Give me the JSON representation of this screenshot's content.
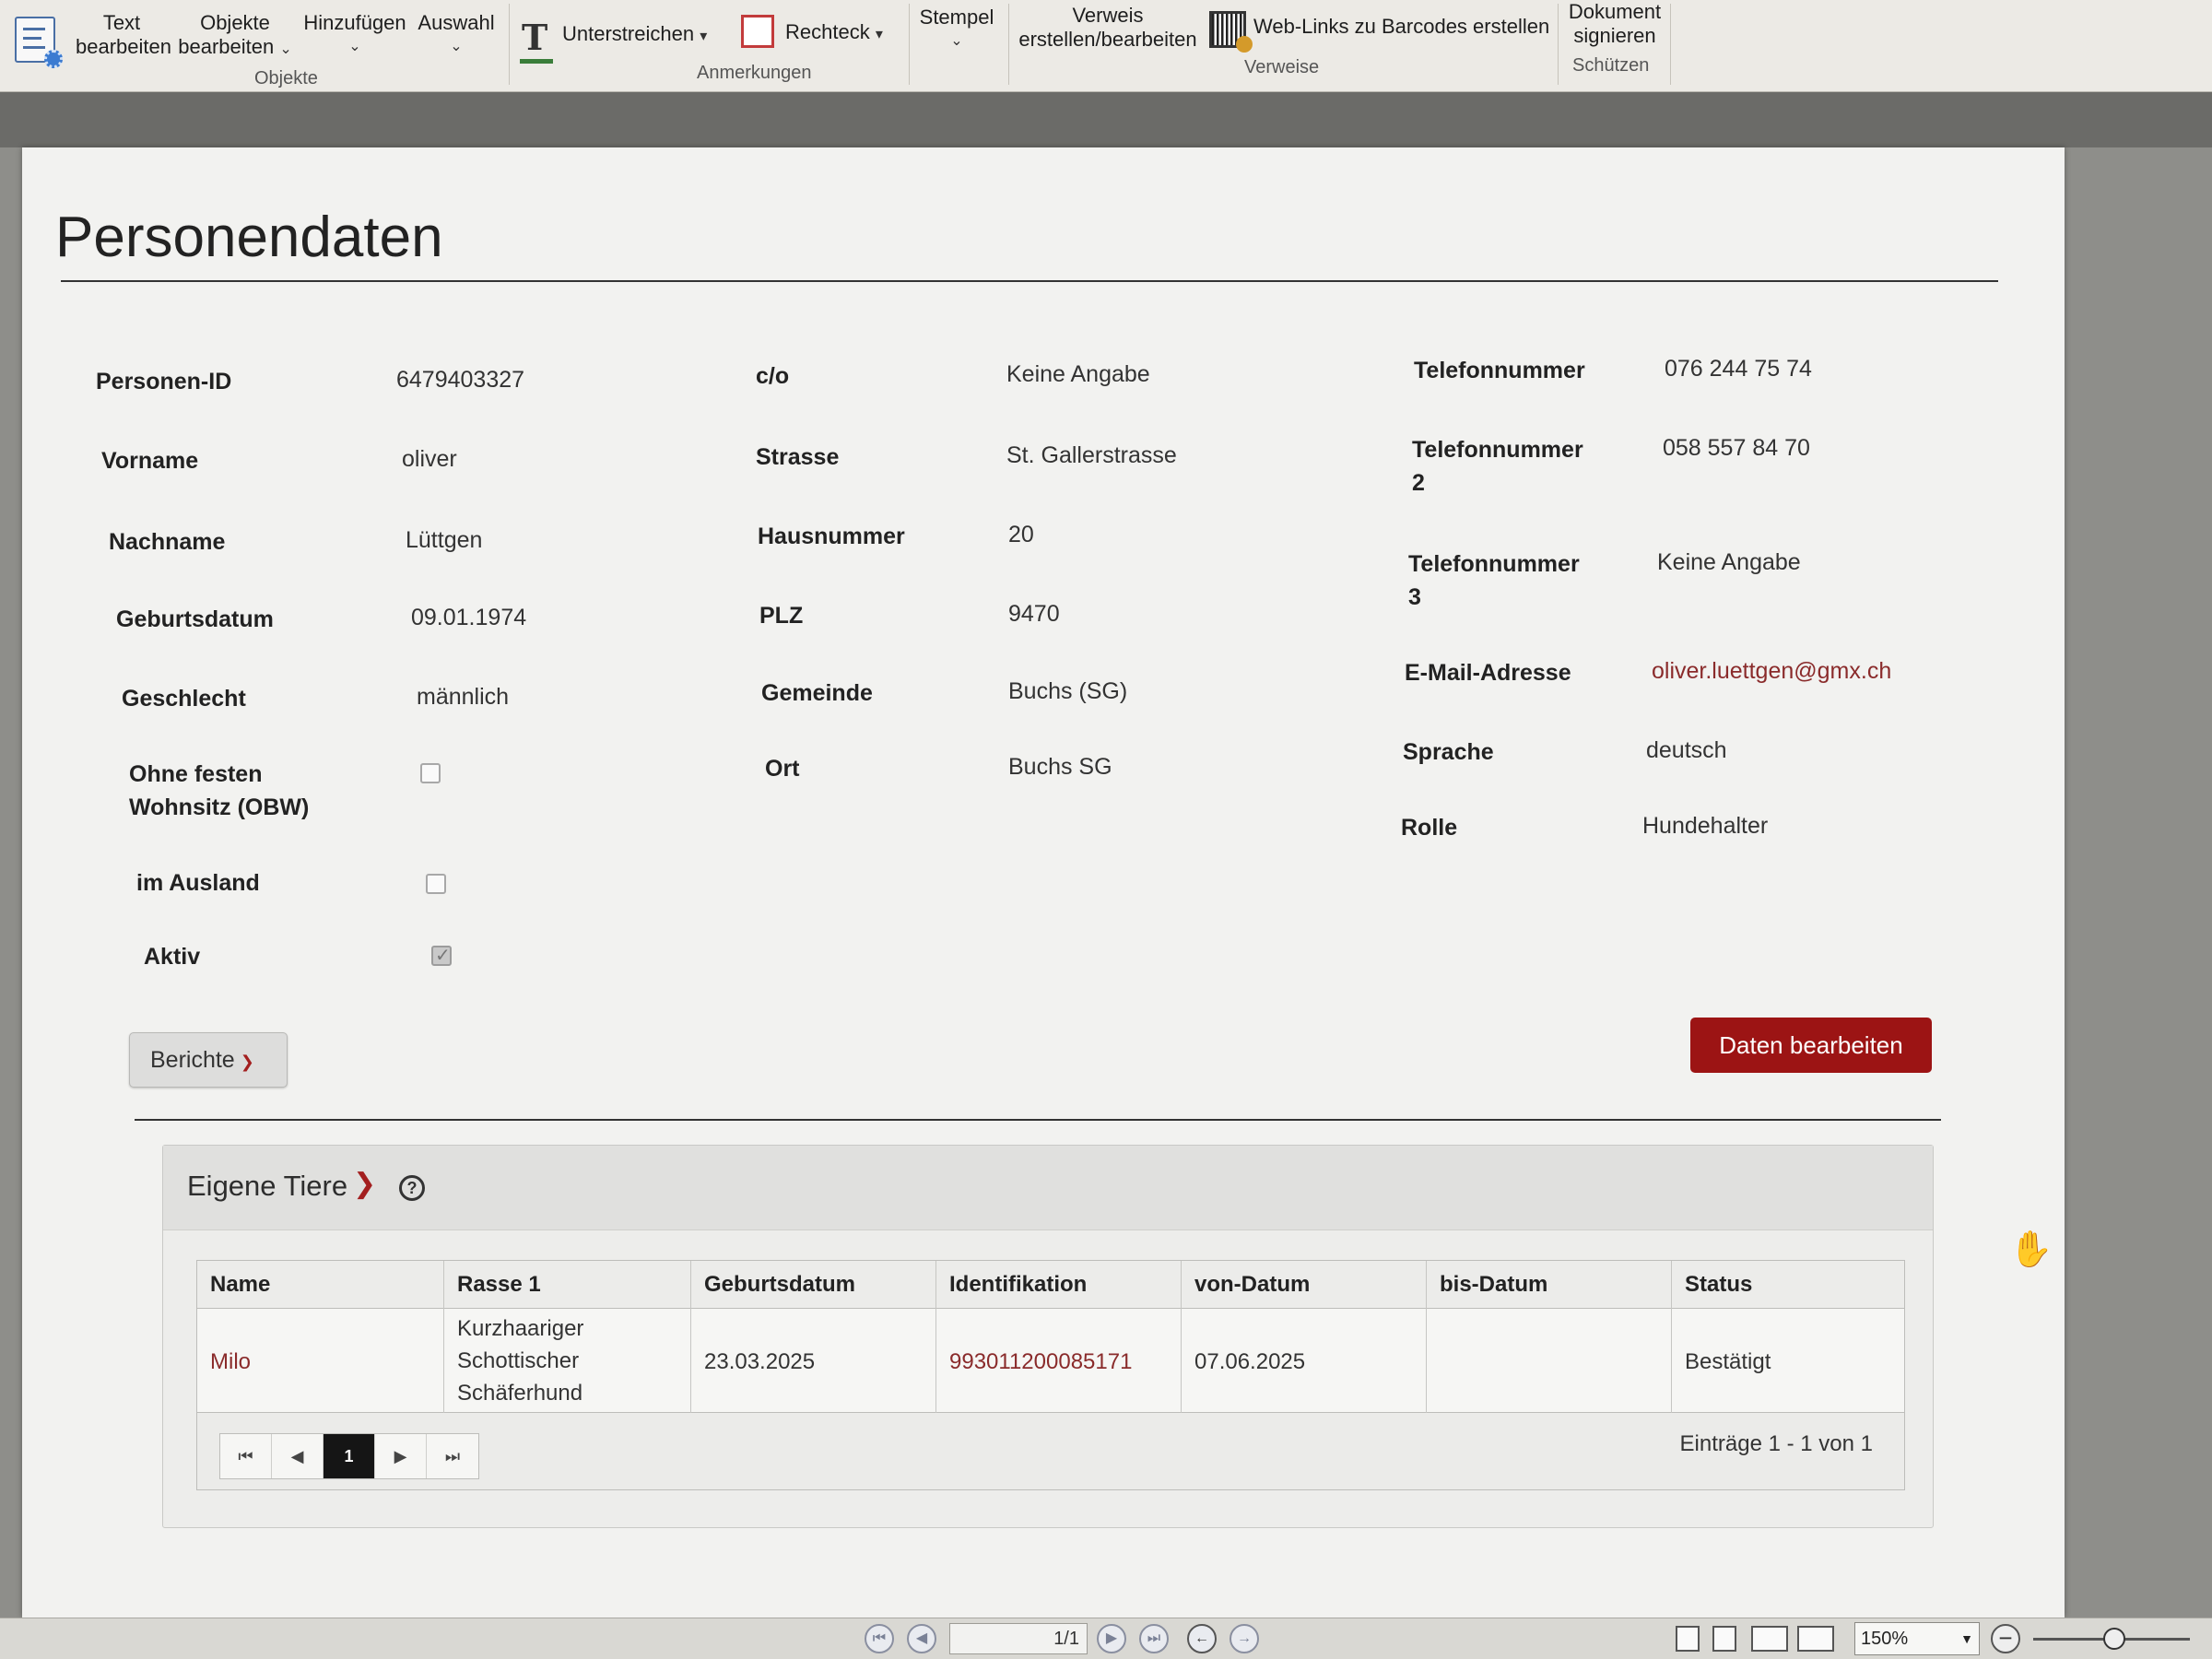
{
  "ribbon": {
    "text_edit": [
      "Text",
      "bearbeiten"
    ],
    "objects_edit": [
      "Objekte",
      "bearbeiten"
    ],
    "add": "Hinzufügen",
    "select": "Auswahl",
    "group_objects": "Objekte",
    "underline": "Unterstreichen",
    "rectangle": "Rechteck",
    "stamp": "Stempel",
    "group_annotations": "Anmerkungen",
    "link_create": [
      "Verweis",
      "erstellen/bearbeiten"
    ],
    "weblinks_barcodes": "Web-Links zu Barcodes erstellen",
    "group_links": "Verweise",
    "sign": [
      "Dokument",
      "signieren"
    ],
    "group_protect": "Schützen"
  },
  "page": {
    "title": "Personendaten"
  },
  "col1": [
    {
      "label": "Personen-ID",
      "value": "6479403327"
    },
    {
      "label": "Vorname",
      "value": "oliver"
    },
    {
      "label": "Nachname",
      "value": "Lüttgen"
    },
    {
      "label": "Geburtsdatum",
      "value": "09.01.1974"
    },
    {
      "label": "Geschlecht",
      "value": "männlich"
    },
    {
      "label_lines": [
        "Ohne festen",
        "Wohnsitz (OBW)"
      ],
      "checked": false
    },
    {
      "label": "im Ausland",
      "checked": false
    },
    {
      "label": "Aktiv",
      "checked": true
    }
  ],
  "col2": [
    {
      "label": "c/o",
      "value": "Keine Angabe"
    },
    {
      "label": "Strasse",
      "value": "St. Gallerstrasse"
    },
    {
      "label": "Hausnummer",
      "value": "20"
    },
    {
      "label": "PLZ",
      "value": "9470"
    },
    {
      "label": "Gemeinde",
      "value": "Buchs (SG)"
    },
    {
      "label": "Ort",
      "value": "Buchs SG"
    }
  ],
  "col3": [
    {
      "label": "Telefonnummer",
      "value": "076 244 75 74"
    },
    {
      "label_lines": [
        "Telefonnummer",
        "2"
      ],
      "value": "058 557 84 70"
    },
    {
      "label_lines": [
        "Telefonnummer",
        "3"
      ],
      "value": "Keine Angabe"
    },
    {
      "label": "E-Mail-Adresse",
      "value": "oliver.luettgen@gmx.ch"
    },
    {
      "label": "Sprache",
      "value": "deutsch"
    },
    {
      "label": "Rolle",
      "value": "Hundehalter"
    }
  ],
  "buttons": {
    "reports": "Berichte",
    "edit": "Daten bearbeiten"
  },
  "animals": {
    "title": "Eigene Tiere",
    "columns": [
      "Name",
      "Rasse 1",
      "Geburtsdatum",
      "Identifikation",
      "von-Datum",
      "bis-Datum",
      "Status"
    ],
    "rows": [
      {
        "name": "Milo",
        "breed_lines": [
          "Kurzhaariger",
          "Schottischer",
          "Schäferhund"
        ],
        "birthdate": "23.03.2025",
        "id": "993011200085171",
        "from": "07.06.2025",
        "to": "",
        "status": "Bestätigt"
      }
    ],
    "pager": {
      "current_page": "1",
      "info": "Einträge 1 - 1 von 1"
    }
  },
  "statusbar": {
    "page_field": "1/1",
    "zoom": "150%"
  },
  "colors": {
    "accent": "#9c1414",
    "link": "#8a2b2b"
  }
}
